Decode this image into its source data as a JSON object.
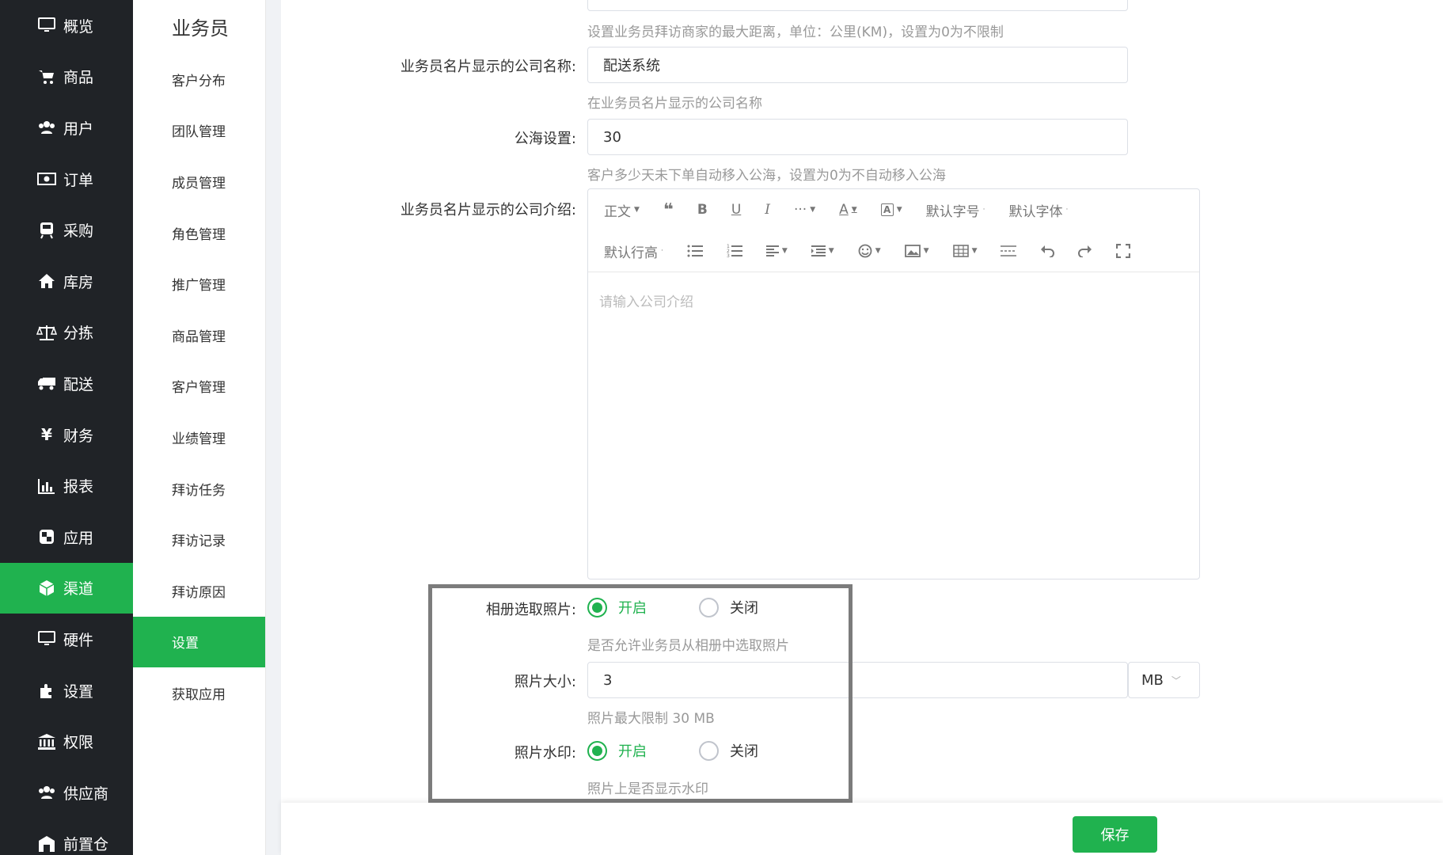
{
  "nav": {
    "items": [
      {
        "label": "概览",
        "icon": "monitor-icon"
      },
      {
        "label": "商品",
        "icon": "cart-icon"
      },
      {
        "label": "用户",
        "icon": "users-icon"
      },
      {
        "label": "订单",
        "icon": "money-icon"
      },
      {
        "label": "采购",
        "icon": "train-icon"
      },
      {
        "label": "库房",
        "icon": "home-icon"
      },
      {
        "label": "分拣",
        "icon": "scale-icon"
      },
      {
        "label": "配送",
        "icon": "truck-icon"
      },
      {
        "label": "财务",
        "icon": "yen-icon"
      },
      {
        "label": "报表",
        "icon": "bar-chart-icon"
      },
      {
        "label": "应用",
        "icon": "apps-icon"
      },
      {
        "label": "渠道",
        "icon": "cube-icon"
      },
      {
        "label": "硬件",
        "icon": "desktop-icon"
      },
      {
        "label": "设置",
        "icon": "puzzle-icon"
      },
      {
        "label": "权限",
        "icon": "bank-icon"
      },
      {
        "label": "供应商",
        "icon": "users-icon"
      },
      {
        "label": "前置仓",
        "icon": "warehouse-icon"
      }
    ],
    "active_index": 11
  },
  "submenu": {
    "title": "业务员",
    "items": [
      "客户分布",
      "团队管理",
      "成员管理",
      "角色管理",
      "推广管理",
      "商品管理",
      "客户管理",
      "业绩管理",
      "拜访任务",
      "拜访记录",
      "拜访原因",
      "设置",
      "获取应用"
    ],
    "active_index": 11
  },
  "form": {
    "distance_hint": "设置业务员拜访商家的最大距离，单位：公里(KM)，设置为0为不限制",
    "company_name_label": "业务员名片显示的公司名称:",
    "company_name_value": "配送系统",
    "company_name_hint": "在业务员名片显示的公司名称",
    "sea_label": "公海设置:",
    "sea_value": "30",
    "sea_hint": "客户多少天未下单自动移入公海，设置为0为不自动移入公海",
    "intro_label": "业务员名片显示的公司介绍:",
    "intro_placeholder": "请输入公司介绍",
    "album_label": "相册选取照片:",
    "album_on": "开启",
    "album_off": "关闭",
    "album_hint": "是否允许业务员从相册中选取照片",
    "photo_size_label": "照片大小:",
    "photo_size_value": "3",
    "photo_size_unit": "MB",
    "photo_size_hint": "照片最大限制 30 MB",
    "watermark_label": "照片水印:",
    "watermark_on": "开启",
    "watermark_off": "关闭",
    "watermark_hint": "照片上是否显示水印"
  },
  "editor_toolbar": {
    "paragraph": "正文",
    "font_size": "默认字号",
    "font_family": "默认字体",
    "line_height": "默认行高"
  },
  "footer": {
    "save_label": "保存"
  },
  "colors": {
    "nav_bg": "#202327",
    "accent": "#20b24f"
  }
}
